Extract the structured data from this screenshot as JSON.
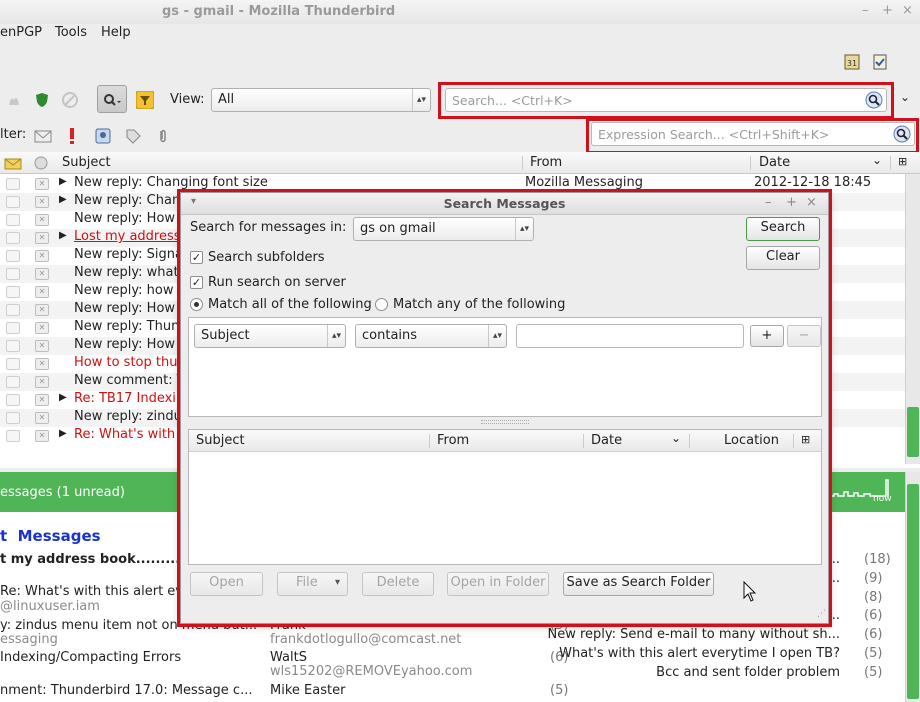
{
  "window": {
    "title": "gs - gmail - Mozilla Thunderbird"
  },
  "menu": {
    "items": [
      "enPGP",
      "Tools",
      "Help"
    ]
  },
  "toolbar": {
    "view_label": "View:",
    "view_value": "All",
    "search_placeholder": "Search... <Ctrl+K>",
    "filter_label": "lter:",
    "expression_placeholder": "Expression Search... <Ctrl+Shift+K>"
  },
  "thread_list": {
    "columns": {
      "subject": "Subject",
      "from": "From",
      "date": "Date"
    },
    "rows": [
      {
        "subject": "New reply: Changing font size",
        "from": "Mozilla Messaging",
        "date": "2012-12-18 18:45",
        "twisty": true,
        "red": false
      },
      {
        "subject": "New reply: Chang",
        "from": "",
        "date": "",
        "twisty": true,
        "red": false
      },
      {
        "subject": "New reply: How c",
        "from": "",
        "date": "",
        "twisty": false,
        "red": false
      },
      {
        "subject": "Lost my address",
        "from": "",
        "date": "",
        "twisty": true,
        "red": true,
        "underline": true
      },
      {
        "subject": "New reply: Signa",
        "from": "",
        "date": "",
        "twisty": false,
        "red": false
      },
      {
        "subject": "New reply: what's",
        "from": "",
        "date": "",
        "twisty": false,
        "red": false
      },
      {
        "subject": "New reply: how o",
        "from": "",
        "date": "",
        "twisty": false,
        "red": false
      },
      {
        "subject": "New reply: How D",
        "from": "",
        "date": "",
        "twisty": false,
        "red": false
      },
      {
        "subject": "New reply: Thund",
        "from": "",
        "date": "",
        "twisty": false,
        "red": false
      },
      {
        "subject": "New reply: How c",
        "from": "",
        "date": "",
        "twisty": false,
        "red": false
      },
      {
        "subject": "How to stop thun",
        "from": "",
        "date": "",
        "twisty": false,
        "red": true
      },
      {
        "subject": "New comment: T",
        "from": "",
        "date": "",
        "twisty": false,
        "red": false
      },
      {
        "subject": "Re: TB17 Indexing",
        "from": "",
        "date": "",
        "twisty": true,
        "red": true
      },
      {
        "subject": "New reply: zindus",
        "from": "",
        "date": "",
        "twisty": false,
        "red": false
      },
      {
        "subject": "Re: What's with th",
        "from": "",
        "date": "",
        "twisty": true,
        "red": true
      }
    ]
  },
  "summary": {
    "text": "essages (1 unread)",
    "now": "now"
  },
  "bottom": {
    "heading": "Messages",
    "heading_prefix": "t",
    "subheading": "t my address book..........",
    "left": [
      {
        "subject": "Re: What's with this alert eve",
        "sub": "@linuxuser.iam",
        "from": "",
        "email": "",
        "count": ""
      },
      {
        "subject": "y: zindus menu item not on menu but...",
        "sub": "essaging",
        "from": "Frank",
        "email": "frankdotlogullo@comcast.net",
        "count": "(5)"
      },
      {
        "subject": "Indexing/Compacting Errors",
        "sub": "",
        "from": "WaltS",
        "email": "wls15202@REMOVEyahoo.com",
        "count": "(6)"
      },
      {
        "subject": "nment: Thunderbird 17.0: Message c...",
        "sub": "",
        "from": "Mike Easter",
        "email": "",
        "count": "(5)"
      }
    ],
    "right": [
      {
        "text": "y ...",
        "count": "(18)"
      },
      {
        "text": "vice ...",
        "count": "(9)"
      },
      {
        "text": "",
        "count": "(8)"
      },
      {
        "text": "m 8 ...",
        "count": "(6)"
      },
      {
        "text": "New reply: Send e-mail to many without sh...",
        "count": "(6)"
      },
      {
        "text": "What's with this alert everytime I open TB?",
        "count": "(5)"
      },
      {
        "text": "Bcc and sent folder problem",
        "count": "(5)"
      }
    ]
  },
  "dialog": {
    "title": "Search Messages",
    "search_in_label": "Search for messages in:",
    "search_in_value": "gs on gmail",
    "search_button": "Search",
    "clear_button": "Clear",
    "subfolders_label": "Search subfolders",
    "server_label": "Run search on server",
    "match_all_label": "Match all of the following",
    "match_any_label": "Match any of the following",
    "criteria_field": "Subject",
    "criteria_op": "contains",
    "criteria_value": "",
    "add_button": "+",
    "remove_button": "−",
    "results_columns": {
      "subject": "Subject",
      "from": "From",
      "date": "Date",
      "location": "Location"
    },
    "buttons": {
      "open": "Open",
      "file": "File",
      "delete": "Delete",
      "open_in_folder": "Open in Folder",
      "save_as_search_folder": "Save as Search Folder"
    }
  },
  "colors": {
    "highlight_red": "#d0101a",
    "accent_green": "#4fb556",
    "link_blue": "#1a33cc"
  }
}
